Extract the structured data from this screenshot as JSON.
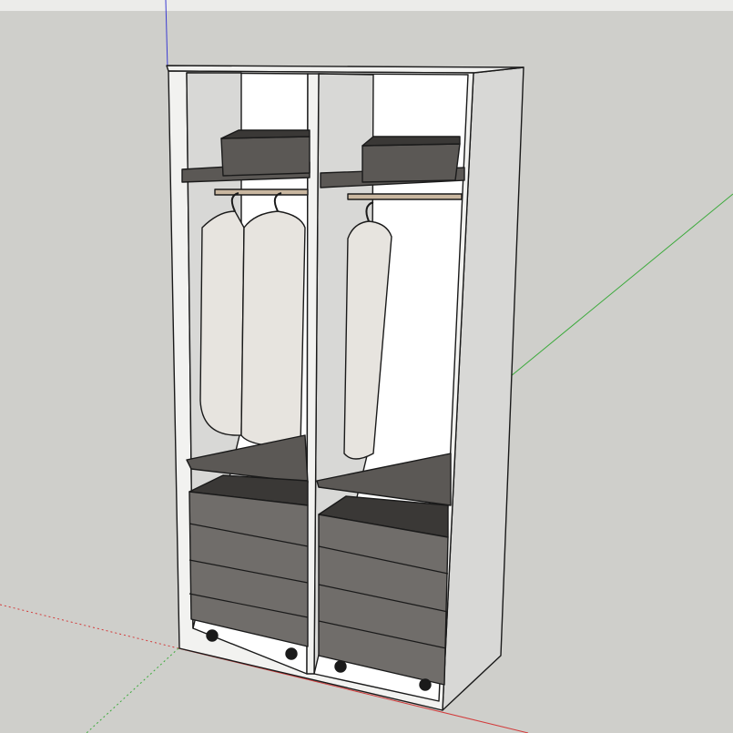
{
  "viewport": {
    "background_color": "#cfcfcb",
    "toolbar_strip_color": "#ececea"
  },
  "axes": {
    "x_color": "#d23c3c",
    "y_color": "#3caa3c",
    "z_color": "#3c3cd2"
  },
  "model": {
    "name": "wardrobe",
    "sections": [
      {
        "name": "left-section",
        "hanging_garments": 2,
        "has_storage_box": true,
        "drawers": 4,
        "casters": 2
      },
      {
        "name": "right-section",
        "hanging_garments": 1,
        "has_storage_box": true,
        "drawers": 4,
        "casters": 2
      }
    ],
    "colors": {
      "carcass": "#f2f2f0",
      "carcass_side": "#d8d8d6",
      "interior": "#ffffff",
      "dark": "#5b5855",
      "drawer_front": "#706d6a",
      "drawer_top": "#3a3836",
      "garment": "#e7e4df",
      "garment_shadow": "#c9c6c1",
      "rail": "#c9b7a0",
      "outline": "#1a1a1a"
    }
  }
}
